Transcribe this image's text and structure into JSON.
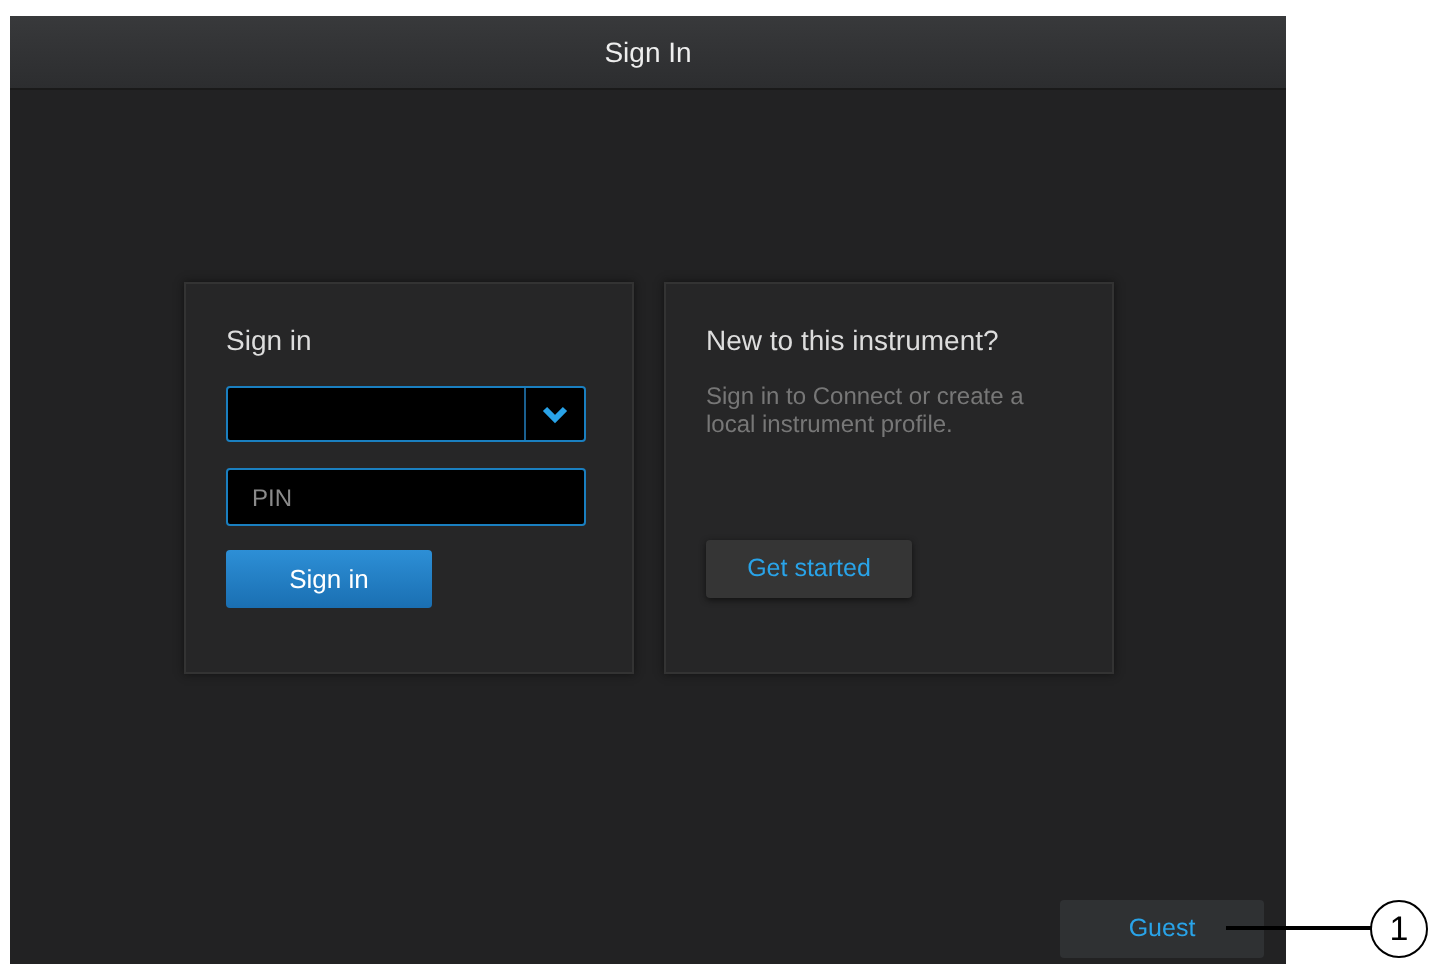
{
  "header": {
    "title": "Sign In"
  },
  "sign_in_card": {
    "title": "Sign in",
    "account_select": {
      "expanded": false
    },
    "pin_field": {
      "placeholder": "PIN"
    },
    "button": "Sign in"
  },
  "new_user_card": {
    "title": "New to this instrument?",
    "description": "Sign in to Connect or create a local instrument profile.",
    "button": "Get started"
  },
  "guest_button": "Guest",
  "callout": {
    "number": "1"
  }
}
